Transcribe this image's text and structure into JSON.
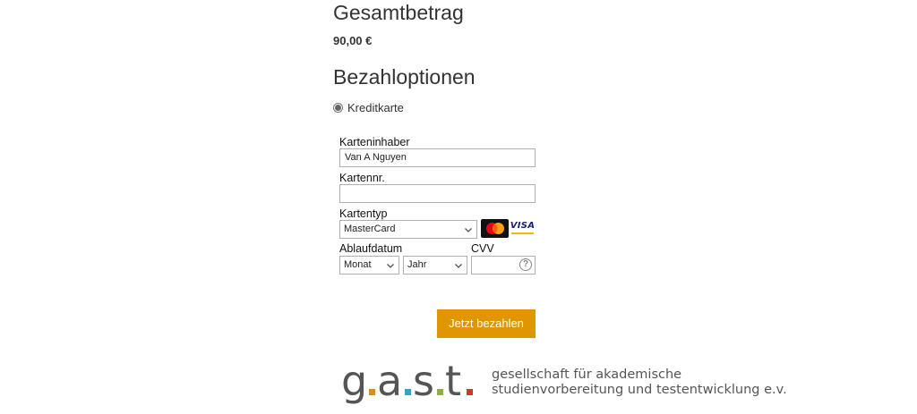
{
  "summary": {
    "total_heading": "Gesamtbetrag",
    "total_amount": "90,00 €"
  },
  "payment": {
    "heading": "Bezahloptionen",
    "method_label": "Kreditkarte",
    "method_selected": true
  },
  "form": {
    "holder_label": "Karteninhaber",
    "holder_value": "Van A Nguyen",
    "number_label": "Kartennr.",
    "number_value": "",
    "type_label": "Kartentyp",
    "type_value": "MasterCard",
    "expiry_label": "Ablaufdatum",
    "month_value": "Monat",
    "year_value": "Jahr",
    "cvv_label": "CVV",
    "cvv_value": "",
    "card_logos": [
      "mastercard-logo",
      "visa-logo"
    ],
    "visa_text": "VISA",
    "help_symbol": "?"
  },
  "actions": {
    "pay_label": "Jetzt bezahlen",
    "pay_color": "#e09600"
  },
  "footer": {
    "logo_text": "g.a.s.t.",
    "logo_dot_colors": [
      "#e08a1e",
      "#3aa0c8",
      "#8bb23a",
      "#d2382a"
    ],
    "tagline_line1": "gesellschaft für akademische",
    "tagline_line2": "studienvorbereitung und testentwicklung e.v."
  }
}
